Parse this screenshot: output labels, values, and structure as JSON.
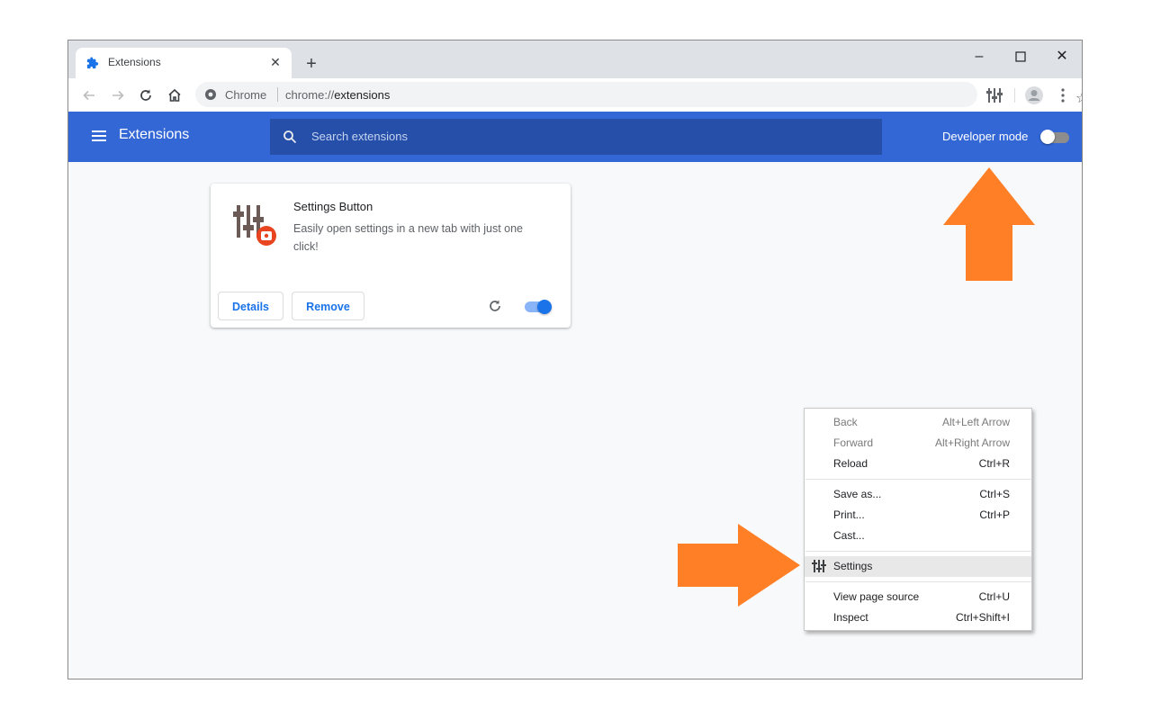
{
  "tab": {
    "title": "Extensions",
    "close": "✕",
    "new_tab": "+"
  },
  "window_controls": {
    "minimize": "–",
    "maximize": "☐",
    "close": "✕"
  },
  "omnibox": {
    "scheme_label": "Chrome",
    "url_prefix": "chrome://",
    "url_host": "extensions"
  },
  "extensions_page": {
    "title": "Extensions",
    "search_placeholder": "Search extensions",
    "developer_mode_label": "Developer mode",
    "developer_mode_on": false
  },
  "extension_card": {
    "name": "Settings Button",
    "description": "Easily open settings in a new tab with just one click!",
    "details_label": "Details",
    "remove_label": "Remove",
    "enabled": true
  },
  "context_menu": {
    "items": [
      {
        "label": "Back",
        "shortcut": "Alt+Left Arrow",
        "disabled": true
      },
      {
        "label": "Forward",
        "shortcut": "Alt+Right Arrow",
        "disabled": true
      },
      {
        "label": "Reload",
        "shortcut": "Ctrl+R",
        "disabled": false
      },
      {
        "label": "Save as...",
        "shortcut": "Ctrl+S",
        "disabled": false
      },
      {
        "label": "Print...",
        "shortcut": "Ctrl+P",
        "disabled": false
      },
      {
        "label": "Cast...",
        "shortcut": "",
        "disabled": false
      },
      {
        "label": "Settings",
        "shortcut": "",
        "disabled": false,
        "highlighted": true,
        "icon": "sliders-icon"
      },
      {
        "label": "View page source",
        "shortcut": "Ctrl+U",
        "disabled": false
      },
      {
        "label": "Inspect",
        "shortcut": "Ctrl+Shift+I",
        "disabled": false
      }
    ]
  },
  "colors": {
    "header": "#3367d6",
    "accent": "#1a73e8",
    "arrow": "#ff7f27"
  }
}
